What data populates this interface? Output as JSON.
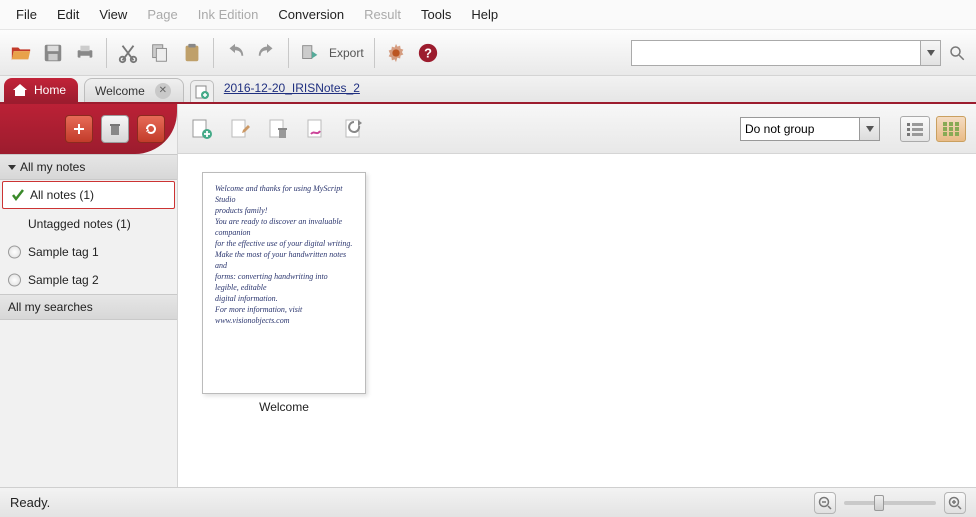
{
  "menu": {
    "file": "File",
    "edit": "Edit",
    "view": "View",
    "page": "Page",
    "ink_edition": "Ink Edition",
    "conversion": "Conversion",
    "result": "Result",
    "tools": "Tools",
    "help": "Help"
  },
  "toolbar": {
    "export_label": "Export",
    "search_placeholder": ""
  },
  "tabs": {
    "home": "Home",
    "welcome": "Welcome",
    "document_link": "2016-12-20_IRISNotes_2"
  },
  "sidebar": {
    "all_my_notes_header": "All my notes",
    "all_notes": "All notes (1)",
    "untagged": "Untagged notes (1)",
    "sample1": "Sample tag 1",
    "sample2": "Sample tag 2",
    "all_searches_header": "All my searches"
  },
  "content": {
    "group_option": "Do not group",
    "note_title": "Welcome",
    "handwriting": [
      "Welcome and thanks for using MyScript Studio",
      "products family!",
      "You are ready to discover an invaluable companion",
      "for the effective use of your digital writing.",
      "Make the most of your handwritten notes and",
      "forms: converting handwriting into legible, editable",
      "digital information.",
      "For more information, visit www.visionobjects.com"
    ]
  },
  "status": {
    "text": "Ready."
  },
  "colors": {
    "accent": "#9c1c2e"
  }
}
